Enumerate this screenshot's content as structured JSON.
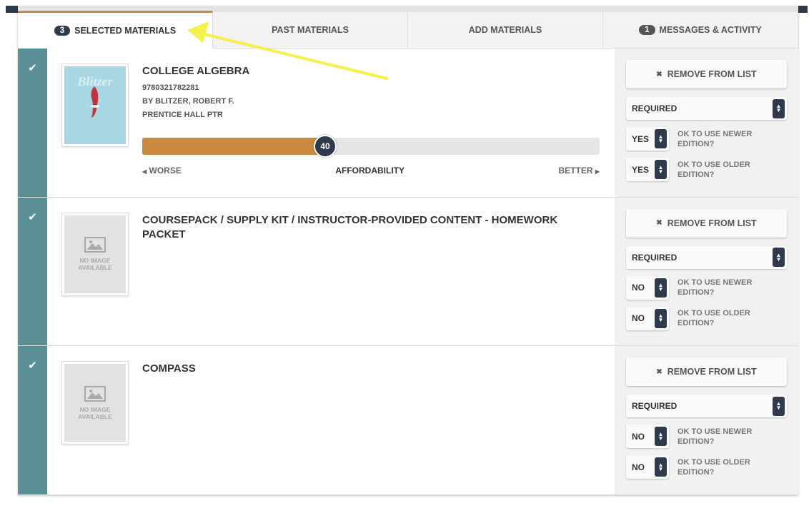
{
  "colors": {
    "accent": "#c98a3f",
    "dark": "#2f3a4c",
    "teal": "#5a8f96",
    "annotation_arrow": "#f5f04a"
  },
  "tabs": [
    {
      "badge": "3",
      "label": "SELECTED MATERIALS",
      "active": true
    },
    {
      "badge": "",
      "label": "PAST MATERIALS"
    },
    {
      "badge": "",
      "label": "ADD MATERIALS"
    },
    {
      "badge": "1",
      "label": "MESSAGES & ACTIVITY"
    }
  ],
  "materials": [
    {
      "title": "COLLEGE ALGEBRA",
      "isbn": "9780321782281",
      "author": "BY BLITZER, ROBERT F.",
      "publisher": "PRENTICE HALL PTR",
      "cover_text": "Blitzer",
      "has_image": true,
      "affordability": {
        "value": 40,
        "min_label": "WORSE",
        "label": "AFFORDABILITY",
        "max_label": "BETTER"
      },
      "remove_label": "REMOVE FROM LIST",
      "requirement": "REQUIRED",
      "newer": "YES",
      "older": "YES"
    },
    {
      "title": "COURSEPACK / SUPPLY KIT / INSTRUCTOR-PROVIDED CONTENT - HOMEWORK PACKET",
      "has_image": false,
      "remove_label": "REMOVE FROM LIST",
      "requirement": "REQUIRED",
      "newer": "NO",
      "older": "NO"
    },
    {
      "title": "COMPASS",
      "has_image": false,
      "remove_label": "REMOVE FROM LIST",
      "requirement": "REQUIRED",
      "newer": "NO",
      "older": "NO"
    }
  ],
  "labels": {
    "no_image": "NO IMAGE AVAILABLE",
    "newer_edition": "OK TO USE NEWER EDITION?",
    "older_edition": "OK TO USE OLDER EDITION?"
  }
}
